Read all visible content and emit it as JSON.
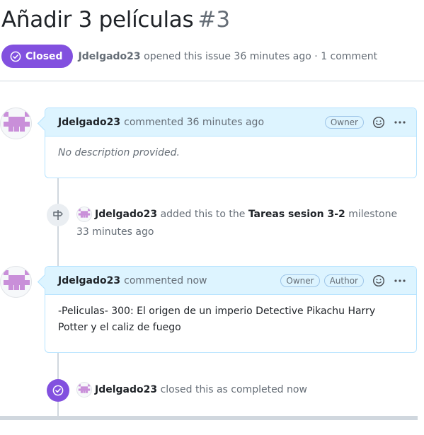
{
  "issue": {
    "title": "Añadir 3 películas",
    "number": "#3",
    "state": "Closed",
    "author": "Jdelgado23",
    "opened_text": "opened this issue 36 minutes ago · 1 comment"
  },
  "comments": [
    {
      "author": "Jdelgado23",
      "time_text": "commented 36 minutes ago",
      "badges": [
        "Owner"
      ],
      "body": "No description provided."
    },
    {
      "author": "Jdelgado23",
      "time_text": "commented now",
      "badges": [
        "Owner",
        "Author"
      ],
      "body": "-Peliculas- 300: El origen de un imperio Detective Pikachu Harry Potter y el caliz de fuego"
    }
  ],
  "events": {
    "milestone": {
      "author": "Jdelgado23",
      "action": "added this to the",
      "milestone": "Tareas sesion 3-2",
      "suffix": "milestone",
      "time": "33 minutes ago"
    },
    "closed": {
      "author": "Jdelgado23",
      "action": "closed this as completed now"
    }
  },
  "colors": {
    "closed_purple": "#8250df",
    "comment_header_bg": "#ddf4ff",
    "comment_border": "#b6e3ff",
    "avatar_color": "#c98fd9"
  },
  "icons": [
    "check-circle-icon",
    "smiley-icon",
    "kebab-icon",
    "milestone-icon",
    "check-circle-icon"
  ]
}
